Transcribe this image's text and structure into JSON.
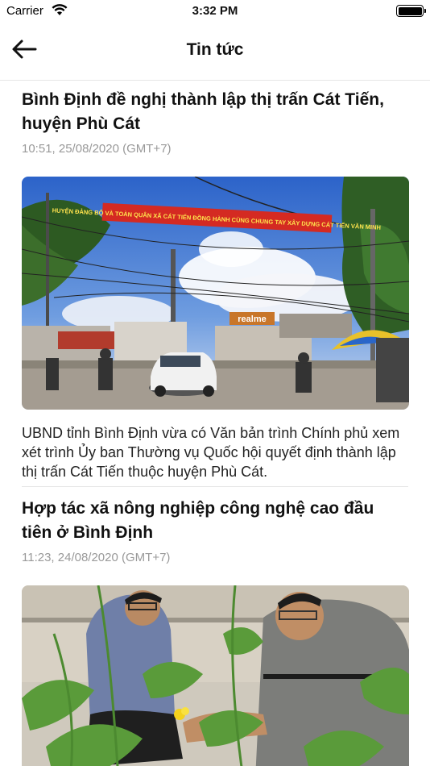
{
  "status_bar": {
    "carrier": "Carrier",
    "time": "3:32 PM",
    "icons": [
      "wifi-icon",
      "battery-icon"
    ]
  },
  "nav": {
    "title": "Tin tức",
    "back_icon": "back-arrow-icon"
  },
  "articles": [
    {
      "title": "Bình Định đề nghị thành lập thị trấn Cát Tiến, huyện Phù Cát",
      "time": "10:51, 25/08/2020 (GMT+7)",
      "banner_text": "HUYỆN ĐẢNG BỘ VÀ TOÀN QUÂN XÃ CÁT TIẾN ĐỒNG HÀNH CÙNG CHUNG TAY XÂY DỰNG CÁT TIẾN VĂN MINH",
      "shop_sign": "realme",
      "summary": "UBND tỉnh Bình Định vừa có Văn bản trình Chính phủ xem xét trình Ủy ban Thường vụ Quốc hội quyết định thành lập thị trấn Cát Tiến thuộc huyện Phù Cát."
    },
    {
      "title": "Hợp tác xã nông nghiệp công nghệ cao đầu tiên ở Bình Định",
      "time": "11:23, 24/08/2020 (GMT+7)"
    }
  ]
}
